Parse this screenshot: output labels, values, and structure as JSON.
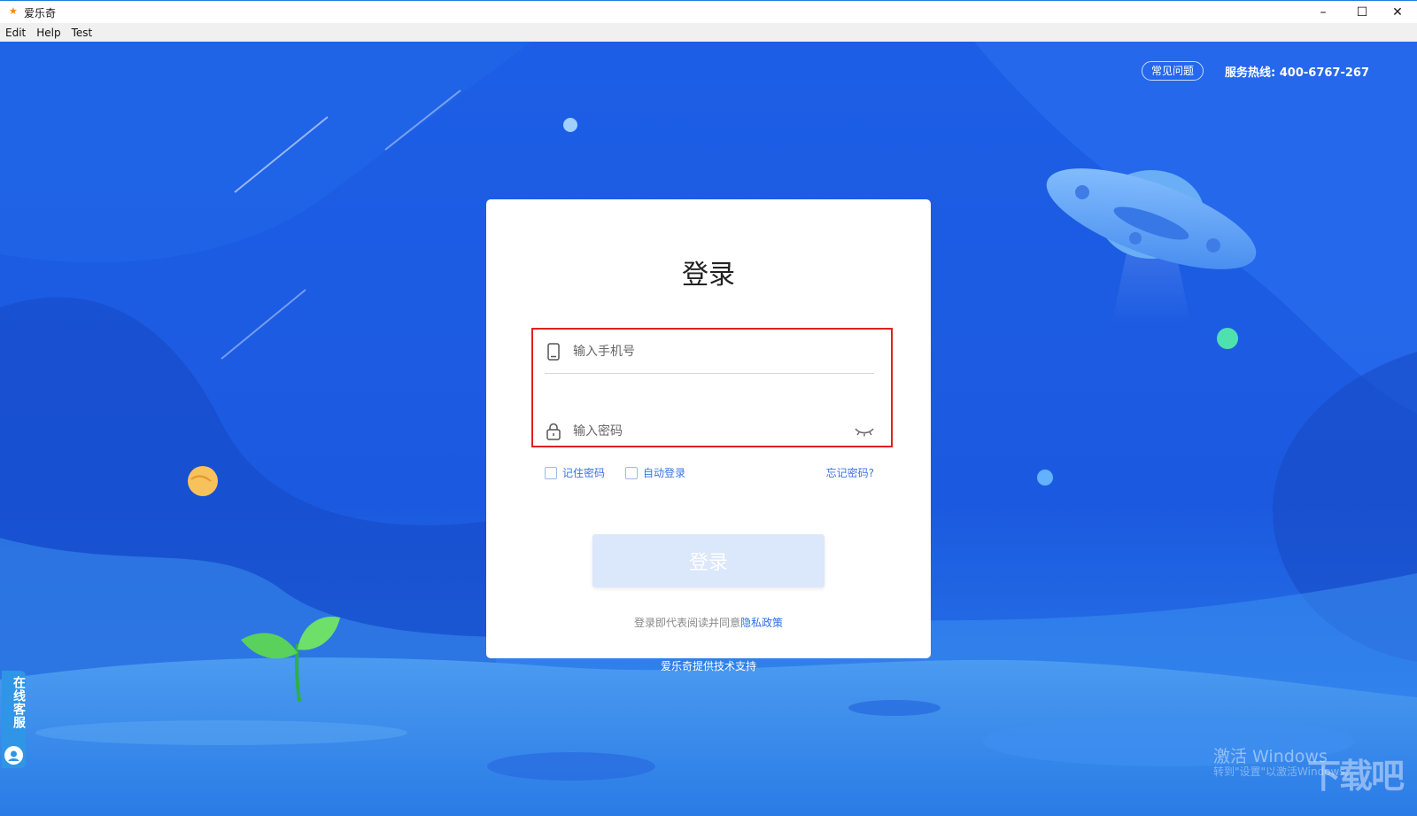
{
  "window": {
    "title": "爱乐奇",
    "controls": {
      "minimize": "–",
      "maximize": "☐",
      "close": "✕"
    }
  },
  "menu": {
    "items": [
      "Edit",
      "Help",
      "Test"
    ]
  },
  "header": {
    "faq_label": "常见问题",
    "hotline": "服务热线: 400-6767-267"
  },
  "login": {
    "title": "登录",
    "phone_placeholder": "输入手机号",
    "password_placeholder": "输入密码",
    "remember_label": "记住密码",
    "auto_login_label": "自动登录",
    "forgot_label": "忘记密码?",
    "submit_label": "登录",
    "agreement_text": "登录即代表阅读并同意",
    "privacy_link": "隐私政策"
  },
  "footer": {
    "support_text": "爱乐奇提供技术支持"
  },
  "side_tab": {
    "label": "在线客服"
  },
  "watermark": {
    "activate_title": "激活 Windows",
    "activate_subtitle": "转到\"设置\"以激活Windows。",
    "site_logo": "下载吧"
  },
  "colors": {
    "background": "#1a5be3",
    "accent": "#2f6fe4",
    "highlight": "#e02020"
  }
}
